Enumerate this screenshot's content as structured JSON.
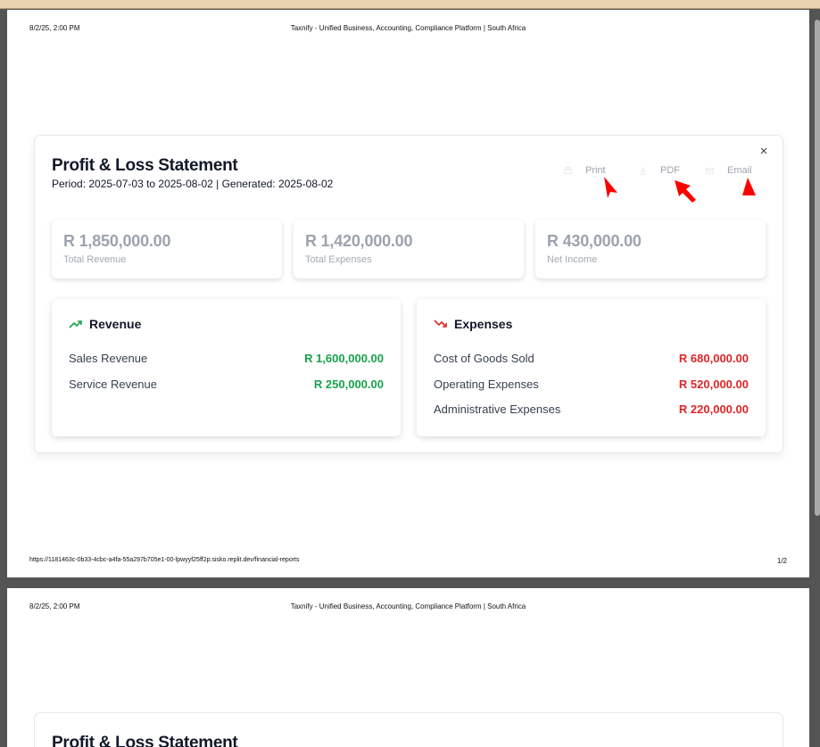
{
  "browser": {
    "print_date": "8/2/25, 2:00 PM",
    "page_title": "Taxnify - Unified Business, Accounting, Compliance Platform | South Africa",
    "url": "https://1181463c-0b33-4cbc-a4fa-55a297b705e1-00-lpwyyf25ff2p.sisko.replit.dev/financial-reports",
    "page_number": "1/2"
  },
  "report": {
    "close_symbol": "×",
    "title": "Profit & Loss Statement",
    "subtitle": "Period: 2025-07-03 to 2025-08-02 | Generated: 2025-08-02",
    "actions": {
      "print": "Print",
      "pdf": "PDF",
      "email": "Email"
    },
    "summary": [
      {
        "amount": "R 1,850,000.00",
        "label": "Total Revenue"
      },
      {
        "amount": "R 1,420,000.00",
        "label": "Total Expenses"
      },
      {
        "amount": "R 430,000.00",
        "label": "Net Income"
      }
    ],
    "revenue": {
      "title": "Revenue",
      "icon": "trending-up-icon",
      "items": [
        {
          "name": "Sales Revenue",
          "amount": "R 1,600,000.00"
        },
        {
          "name": "Service Revenue",
          "amount": "R 250,000.00"
        }
      ]
    },
    "expenses": {
      "title": "Expenses",
      "icon": "trending-down-icon",
      "items": [
        {
          "name": "Cost of Goods Sold",
          "amount": "R 680,000.00"
        },
        {
          "name": "Operating Expenses",
          "amount": "R 520,000.00"
        },
        {
          "name": "Administrative Expenses",
          "amount": "R 220,000.00"
        }
      ]
    }
  },
  "colors": {
    "revenue": "#16a34a",
    "expense": "#dc2626",
    "annotation": "#ff0000",
    "viewer_background": "#545454"
  }
}
